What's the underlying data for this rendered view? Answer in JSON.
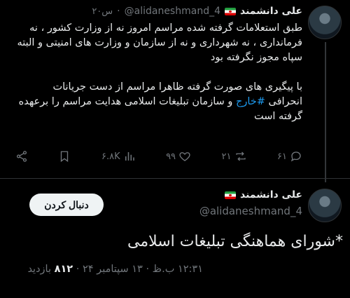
{
  "tweet1": {
    "name": "علی دانشمند",
    "handle": "@alidaneshmand_4",
    "time": "۲۰س",
    "body_part1": "طبق استعلامات گرفته شده مراسم امروز نه از وزارت کشور ، نه فرمانداری ، نه شهرداری و نه از سازمان و وزارت های امنیتی و البته سپاه مجوز نگرفته بود\n\nبا پیگیری های صورت گرفته ظاهرا مراسم از دست جریانات انحرافی ",
    "hashtag": "#خارج",
    "body_part2": " و سازمان تبلیغات اسلامی هدایت مراسم را برعهده گرفته است",
    "replies": "۶۱",
    "retweets": "۲۱",
    "likes": "۹۹",
    "views": "۶.۸K"
  },
  "tweet2": {
    "name": "علی دانشمند",
    "handle": "@alidaneshmand_4",
    "follow_label": "دنبال کردن",
    "body": "*شورای هماهنگی تبلیغات اسلامی",
    "meta_time": "۱۲:۳۱ ب.ظ · ۱۳ سپتامبر ۲۴ · ",
    "meta_views_count": "۸۱۲",
    "meta_views_label": " بازدید"
  },
  "icons": {
    "reply": "reply-icon",
    "retweet": "retweet-icon",
    "like": "heart-icon",
    "views": "views-icon",
    "bookmark": "bookmark-icon",
    "share": "share-icon"
  },
  "colors": {
    "background": "#000000",
    "text": "#e7e9ea",
    "muted": "#71767b",
    "link": "#1d9bf0",
    "button_bg": "#eff3f4"
  }
}
